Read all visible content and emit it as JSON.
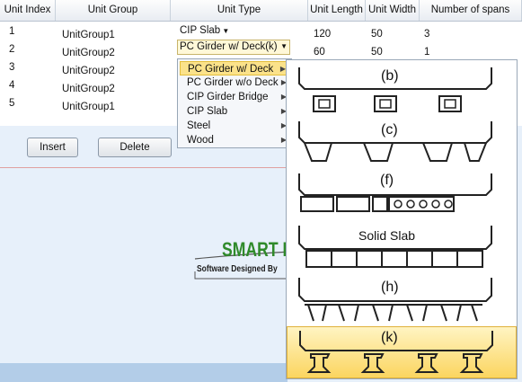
{
  "columns": [
    "Unit Index",
    "Unit Group",
    "Unit Type",
    "Unit Length",
    "Unit Width",
    "Number of spans"
  ],
  "rows": [
    {
      "index": "1",
      "group": "UnitGroup1",
      "type": "CIP Slab",
      "length": "120",
      "width": "50",
      "spans": "3"
    },
    {
      "index": "2",
      "group": "UnitGroup2",
      "type": "PC Girder w/ Deck(k)",
      "length": "60",
      "width": "50",
      "spans": "1"
    },
    {
      "index": "3",
      "group": "UnitGroup2",
      "type": "",
      "length": "",
      "width": "",
      "spans": ""
    },
    {
      "index": "4",
      "group": "UnitGroup2",
      "type": "",
      "length": "",
      "width": "",
      "spans": ""
    },
    {
      "index": "5",
      "group": "UnitGroup1",
      "type": "",
      "length": "",
      "width": "",
      "spans": ""
    }
  ],
  "buttons": {
    "insert": "Insert",
    "delete": "Delete"
  },
  "logo": {
    "title": "SMART BR",
    "subtitle": "Software Designed By"
  },
  "type_menu": [
    "PC Girder w/ Deck",
    "PC Girder w/o Deck",
    "CIP Girder Bridge",
    "CIP Slab",
    "Steel",
    "Wood"
  ],
  "section_options": [
    "(b)",
    "(c)",
    "(f)",
    "Solid Slab",
    "(h)",
    "(k)"
  ]
}
